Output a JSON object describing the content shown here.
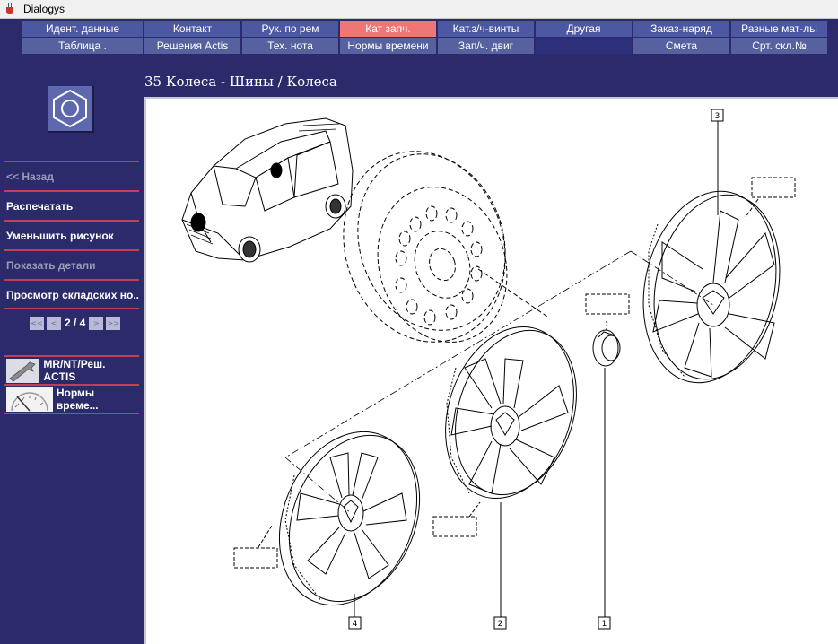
{
  "window": {
    "title": "Dialogys"
  },
  "nav": {
    "row1": [
      "Идент. данные",
      "Контакт",
      "Рук. по рем",
      "Кат запч.",
      "Кат.з/ч-винты",
      "Другая",
      "Заказ-наряд",
      "Разные мат-лы"
    ],
    "row2": [
      "Таблица .",
      "Решения Actis",
      "Тех. нота",
      "Нормы времени",
      "Зап/ч. двиг",
      "Смета",
      "Срт. скл.№"
    ]
  },
  "sidebar": {
    "back": "<< Назад",
    "print": "Распечатать",
    "shrink": "Уменьшить рисунок",
    "show_details": "Показать детали",
    "stock_view": "Просмотр складских но...",
    "pager": {
      "first": "<<",
      "prev": "<",
      "text": "2 / 4",
      "next": ">",
      "last": ">>"
    },
    "tools": [
      "MR/NT/Реш. ACTIS",
      "Нормы време..."
    ]
  },
  "content": {
    "title": "35 Колеса - Шины / Колеса",
    "callouts": [
      "3",
      "2",
      "4",
      "1"
    ]
  },
  "colors": {
    "background": "#2b2a6b",
    "nav_button": "#4d58a2",
    "active_tab": "#f07575",
    "separator": "#c43e57"
  }
}
